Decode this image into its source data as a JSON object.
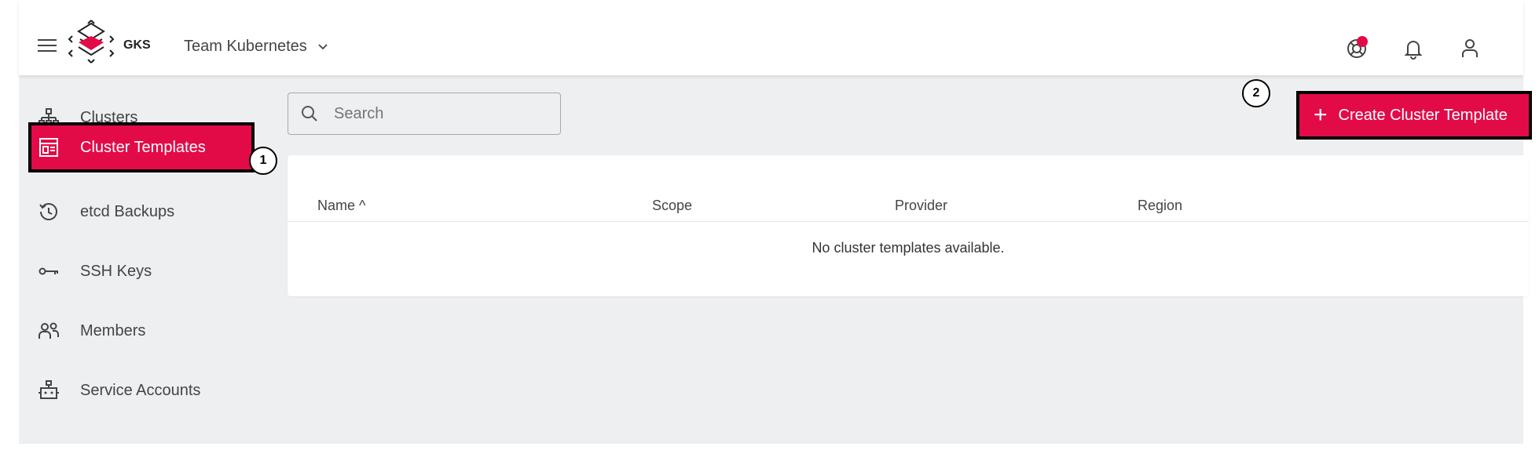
{
  "header": {
    "brand": "GKS",
    "project": "Team Kubernetes",
    "icons": [
      "support-icon",
      "bell-icon",
      "account-icon"
    ]
  },
  "sidebar": {
    "items": [
      {
        "label": "Clusters",
        "icon": "sitemap-icon"
      },
      {
        "label": "Cluster Templates",
        "icon": "template-icon"
      },
      {
        "label": "etcd Backups",
        "icon": "history-icon"
      },
      {
        "label": "SSH Keys",
        "icon": "key-icon"
      },
      {
        "label": "Members",
        "icon": "people-icon"
      },
      {
        "label": "Service Accounts",
        "icon": "robot-icon"
      }
    ],
    "active_index": 1
  },
  "toolbar": {
    "search_placeholder": "Search",
    "create_label": "Create Cluster Template"
  },
  "table": {
    "columns": [
      "Name",
      "Scope",
      "Provider",
      "Region"
    ],
    "sort_indicator": "^",
    "empty_message": "No cluster templates available."
  },
  "annotations": [
    "1",
    "2"
  ],
  "colors": {
    "accent": "#e30a48",
    "background": "#eeeff1",
    "notification_dot": "#e30a48"
  }
}
